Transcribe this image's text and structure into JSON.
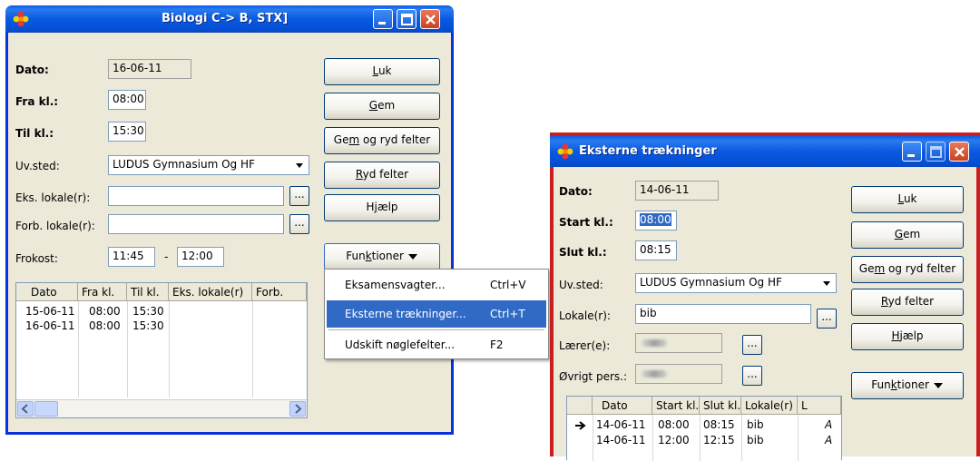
{
  "win1": {
    "title": "Biologi C-> B, STX]",
    "dato_label": "Dato:",
    "dato_value": "16-06-11",
    "fra_label": "Fra kl.:",
    "fra_value": "08:00",
    "til_label": "Til kl.:",
    "til_value": "15:30",
    "uvsted_label": "Uv.sted:",
    "uvsted_value": "LUDUS Gymnasium Og HF",
    "eks_label": "Eks. lokale(r):",
    "eks_value": "",
    "forb_label": "Forb. lokale(r):",
    "forb_value": "",
    "frokost_label": "Frokost:",
    "frokost_from": "11:45",
    "frokost_dash": "-",
    "frokost_to": "12:00",
    "ellipsis": "...",
    "buttons": {
      "luk": {
        "pre": "",
        "u": "L",
        "post": "uk"
      },
      "gem": {
        "pre": "",
        "u": "G",
        "post": "em"
      },
      "gemryd": {
        "pre": "Ge",
        "u": "m",
        "post": " og ryd felter"
      },
      "ryd": {
        "pre": "",
        "u": "R",
        "post": "yd felter"
      },
      "hjaelp": {
        "pre": "H",
        "u": "j",
        "post": "ælp"
      },
      "funktioner": {
        "pre": "Fun",
        "u": "k",
        "post": "tioner"
      }
    },
    "grid": {
      "columns": [
        "Dato",
        "Fra kl.",
        "Til kl.",
        "Eks. lokale(r)",
        "Forb."
      ],
      "rows": [
        [
          "15-06-11",
          "08:00",
          "15:30",
          "",
          ""
        ],
        [
          "16-06-11",
          "08:00",
          "15:30",
          "",
          ""
        ]
      ]
    },
    "menu": [
      {
        "label": "Eksamensvagter...",
        "shortcut": "Ctrl+V"
      },
      {
        "label": "Eksterne trækninger...",
        "shortcut": "Ctrl+T"
      },
      {
        "label": "Udskift nøglefelter...",
        "shortcut": "F2"
      }
    ]
  },
  "win2": {
    "title": "Eksterne trækninger",
    "dato_label": "Dato:",
    "dato_value": "14-06-11",
    "start_label": "Start kl.:",
    "start_value": "08:00",
    "slut_label": "Slut kl.:",
    "slut_value": "08:15",
    "uvsted_label": "Uv.sted:",
    "uvsted_value": "LUDUS Gymnasium Og HF",
    "lokale_label": "Lokale(r):",
    "lokale_value": "bib",
    "laerer_label": "Lærer(e):",
    "oevrigt_label": "Øvrigt pers.:",
    "ellipsis": "...",
    "buttons": {
      "luk": {
        "pre": "",
        "u": "L",
        "post": "uk"
      },
      "gem": {
        "pre": "",
        "u": "G",
        "post": "em"
      },
      "gemryd": {
        "pre": "Ge",
        "u": "m",
        "post": " og ryd felter"
      },
      "ryd": {
        "pre": "",
        "u": "R",
        "post": "yd felter"
      },
      "hjaelp": {
        "pre": "",
        "u": "H",
        "post": "jælp"
      },
      "funktioner": {
        "pre": "Fun",
        "u": "k",
        "post": "tioner"
      }
    },
    "grid": {
      "columns": [
        "Dato",
        "Start kl.",
        "Slut kl.",
        "Lokale(r)",
        "L"
      ],
      "rows": [
        [
          "14-06-11",
          "08:00",
          "08:15",
          "bib",
          "A"
        ],
        [
          "14-06-11",
          "12:00",
          "12:15",
          "bib",
          "A"
        ]
      ]
    }
  },
  "colors": {
    "titlebar": "#0a59e0",
    "dialog_bg": "#ece9d8",
    "highlight": "#316ac5",
    "win2_frame": "#c81e1e"
  },
  "icons": [
    "flower-app-icon",
    "minimize-icon",
    "maximize-icon",
    "close-icon",
    "dropdown-arrow-icon",
    "row-pointer-arrow-icon",
    "scroll-left-icon",
    "scroll-right-icon"
  ]
}
